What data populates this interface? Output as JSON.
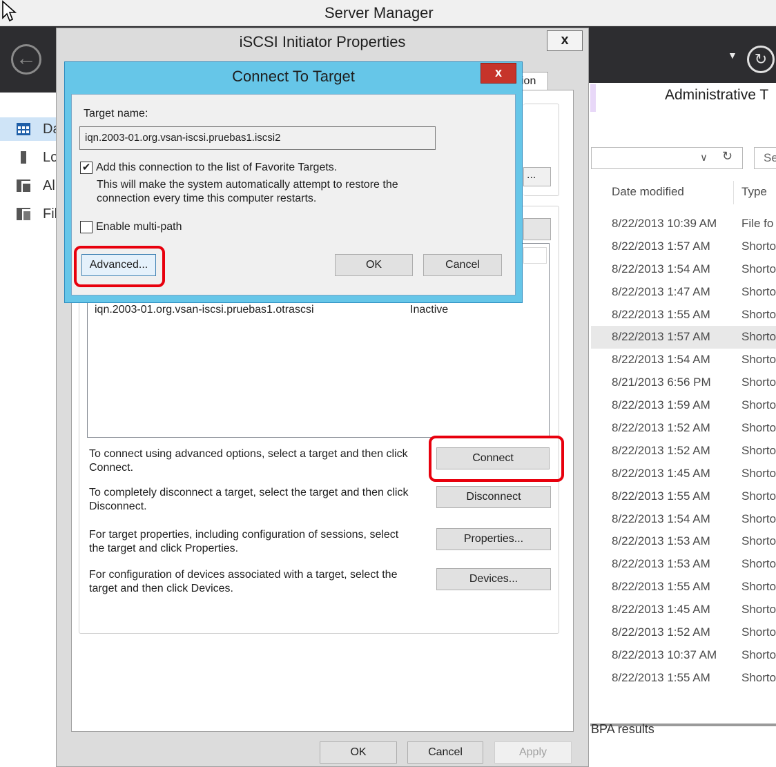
{
  "server_manager": {
    "title": "Server Manager",
    "sidebar": {
      "items": [
        {
          "label": "Da",
          "icon": "dashboard-icon"
        },
        {
          "label": "Lo",
          "icon": "local-server-icon"
        },
        {
          "label": "Al",
          "icon": "all-servers-icon"
        },
        {
          "label": "Fil",
          "icon": "file-services-icon"
        }
      ]
    },
    "admin_tools_title": "Administrative T",
    "search_placeholder": "Se",
    "columns": {
      "date": "Date modified",
      "type": "Type"
    },
    "files": [
      {
        "date": "8/22/2013 10:39 AM",
        "type": "File fo"
      },
      {
        "date": "8/22/2013 1:57 AM",
        "type": "Shorto"
      },
      {
        "date": "8/22/2013 1:54 AM",
        "type": "Shorto"
      },
      {
        "date": "8/22/2013 1:47 AM",
        "type": "Shorto"
      },
      {
        "date": "8/22/2013 1:55 AM",
        "type": "Shorto"
      },
      {
        "date": "8/22/2013 1:57 AM",
        "type": "Shorto"
      },
      {
        "date": "8/22/2013 1:54 AM",
        "type": "Shorto"
      },
      {
        "date": "8/21/2013 6:56 PM",
        "type": "Shorto"
      },
      {
        "date": "8/22/2013 1:59 AM",
        "type": "Shorto"
      },
      {
        "date": "8/22/2013 1:52 AM",
        "type": "Shorto"
      },
      {
        "date": "8/22/2013 1:52 AM",
        "type": "Shorto"
      },
      {
        "date": "8/22/2013 1:45 AM",
        "type": "Shorto"
      },
      {
        "date": "8/22/2013 1:55 AM",
        "type": "Shorto"
      },
      {
        "date": "8/22/2013 1:54 AM",
        "type": "Shorto"
      },
      {
        "date": "8/22/2013 1:53 AM",
        "type": "Shorto"
      },
      {
        "date": "8/22/2013 1:53 AM",
        "type": "Shorto"
      },
      {
        "date": "8/22/2013 1:55 AM",
        "type": "Shorto"
      },
      {
        "date": "8/22/2013 1:45 AM",
        "type": "Shorto"
      },
      {
        "date": "8/22/2013 1:52 AM",
        "type": "Shorto"
      },
      {
        "date": "8/22/2013 10:37 AM",
        "type": "Shorto"
      },
      {
        "date": "8/22/2013 1:55 AM",
        "type": "Shorto"
      }
    ],
    "bpa_label": "BPA results"
  },
  "iscsi": {
    "title": "iSCSI Initiator Properties",
    "close_label": "x",
    "tab_partial": "ion",
    "quick_connect_partial": "...",
    "target_row": {
      "name": "iqn.2003-01.org.vsan-iscsi.pruebas1.otrascsi",
      "status": "Inactive"
    },
    "descriptions": {
      "connect": "To connect using advanced options, select a target and then click Connect.",
      "disconnect": "To completely disconnect a target, select the target and then click Disconnect.",
      "properties": "For target properties, including configuration of sessions, select the target and click Properties.",
      "devices": "For configuration of devices associated with a target, select the target and then click Devices."
    },
    "buttons": {
      "connect": "Connect",
      "disconnect": "Disconnect",
      "properties": "Properties...",
      "devices": "Devices...",
      "ok": "OK",
      "cancel": "Cancel",
      "apply": "Apply"
    }
  },
  "connect_to_target": {
    "title": "Connect To Target",
    "close_label": "x",
    "target_name_label": "Target name:",
    "target_name_value": "iqn.2003-01.org.vsan-iscsi.pruebas1.iscsi2",
    "favorite_checked": true,
    "favorite_label": "Add this connection to the list of Favorite Targets.",
    "favorite_description": "This will make the system automatically attempt to restore the connection every time this computer restarts.",
    "multipath_checked": false,
    "multipath_label": "Enable multi-path",
    "buttons": {
      "advanced": "Advanced...",
      "ok": "OK",
      "cancel": "Cancel"
    }
  },
  "highlight_color": "#e8000d",
  "dialog_title_color": "#66c6e8",
  "close_button_color": "#c6342a"
}
